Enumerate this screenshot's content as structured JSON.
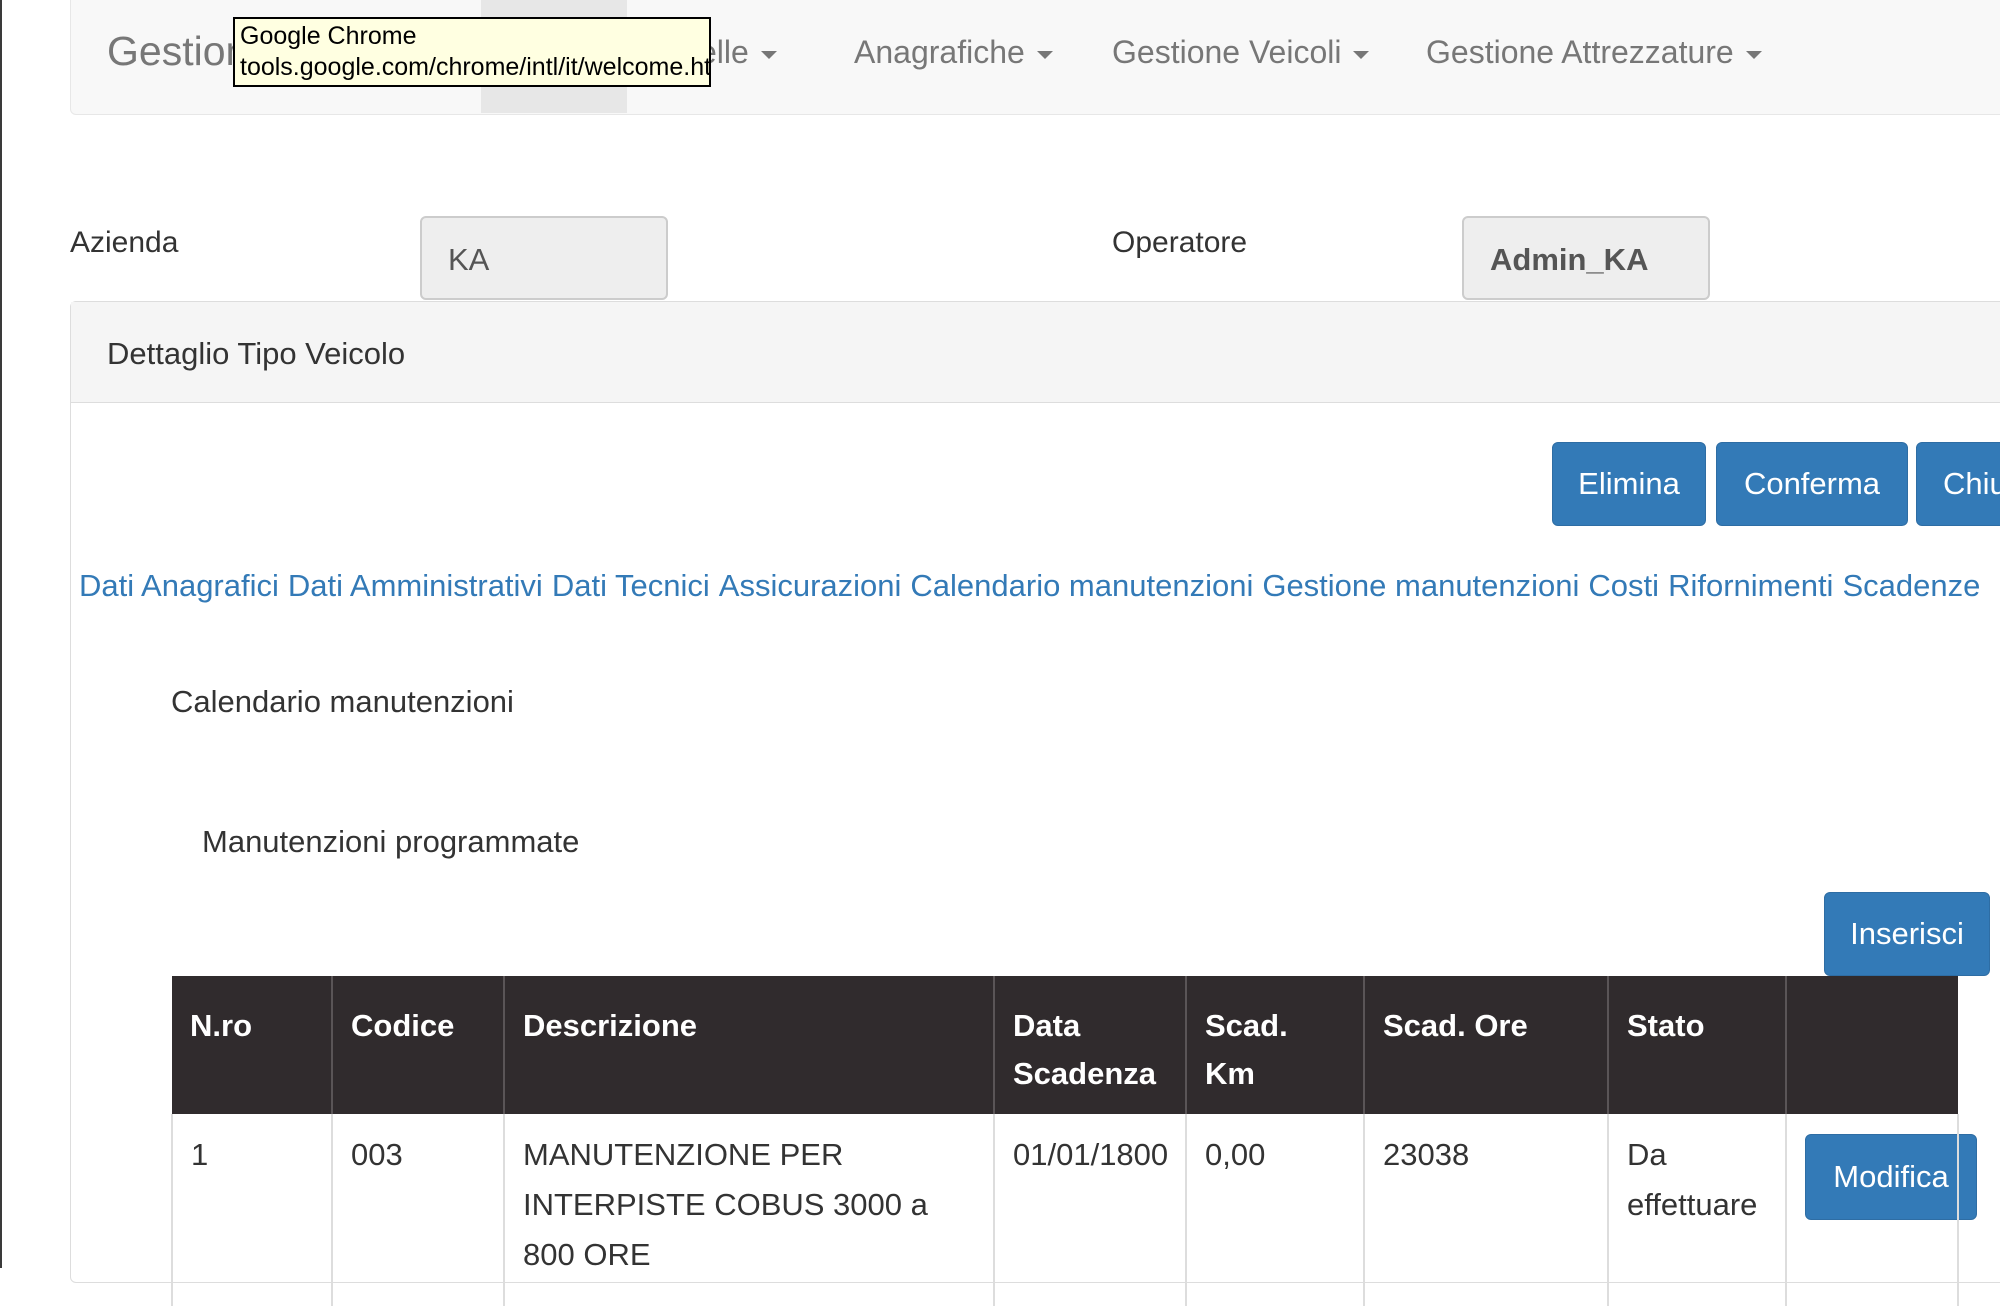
{
  "navbar": {
    "brand": "Gestion",
    "items": [
      {
        "label": "elle"
      },
      {
        "label": "Anagrafiche"
      },
      {
        "label": "Gestione Veicoli"
      },
      {
        "label": "Gestione Attrezzature"
      }
    ]
  },
  "tooltip": {
    "line1": "Google Chrome",
    "line2": "tools.google.com/chrome/intl/it/welcome.html"
  },
  "header": {
    "azienda_label": "Azienda",
    "azienda_value": "KA",
    "operatore_label": "Operatore",
    "operatore_value": "Admin_KA"
  },
  "panel": {
    "title": "Dettaglio Tipo Veicolo",
    "buttons": {
      "elimina": "Elimina",
      "conferma": "Conferma",
      "chiudi": "Chiu"
    },
    "tabs": [
      "Dati Anagrafici",
      "Dati Amministrativi",
      "Dati Tecnici",
      "Assicurazioni",
      "Calendario manutenzioni",
      "Gestione manutenzioni",
      "Costi",
      "Rifornimenti",
      "Scadenze"
    ],
    "section_title": "Calendario manutenzioni",
    "subsection_title": "Manutenzioni programmate",
    "insert_button": "Inserisci"
  },
  "table": {
    "headers": [
      "N.ro",
      "Codice",
      "Descrizione",
      "Data Scadenza",
      "Scad. Km",
      "Scad. Ore",
      "Stato",
      ""
    ],
    "rows": [
      {
        "nro": "1",
        "codice": "003",
        "descrizione": "MANUTENZIONE PER INTERPISTE COBUS 3000 a 800 ORE",
        "data_scadenza": "01/01/1800",
        "scad_km": "0,00",
        "scad_ore": "23038",
        "stato": "Da effettuare",
        "action": "Modifica"
      }
    ]
  },
  "colors": {
    "primary": "#337ab7",
    "table_header": "#302b2d",
    "link": "#337ab7"
  }
}
